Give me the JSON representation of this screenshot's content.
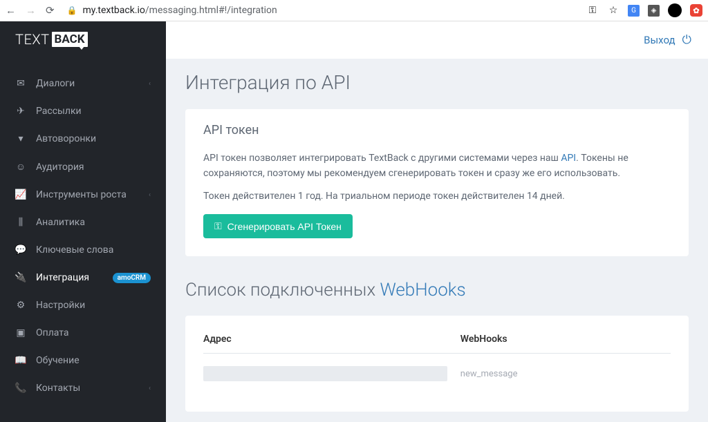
{
  "browser": {
    "url_domain": "my.textback.io",
    "url_path": "/messaging.html#!/integration"
  },
  "logo": {
    "part1": "TEXT",
    "part2": "BACK"
  },
  "sidebar": {
    "items": [
      {
        "label": "Диалоги",
        "icon": "✉",
        "chevron": true
      },
      {
        "label": "Рассылки",
        "icon": "✈"
      },
      {
        "label": "Автоворонки",
        "icon": "▼"
      },
      {
        "label": "Аудитория",
        "icon": "◉"
      },
      {
        "label": "Инструменты роста",
        "icon": "↗",
        "chevron": true
      },
      {
        "label": "Аналитика",
        "icon": "⫼"
      },
      {
        "label": "Ключевые слова",
        "icon": "💬"
      },
      {
        "label": "Интеграция",
        "icon": "⚡",
        "badge": "amoCRM",
        "active": true
      },
      {
        "label": "Настройки",
        "icon": "⚙"
      },
      {
        "label": "Оплата",
        "icon": "▣"
      },
      {
        "label": "Обучение",
        "icon": "📖"
      },
      {
        "label": "Контакты",
        "icon": "📞",
        "chevron": true
      }
    ]
  },
  "topbar": {
    "logout": "Выход"
  },
  "page": {
    "title": "Интеграция по API",
    "card_title": "API токен",
    "desc_before": "API токен позволяет интегрировать TextBack с другими системами через наш ",
    "desc_link": "API",
    "desc_after": ". Токены не сохраняются, поэтому мы рекомендуем сгенерировать токен и сразу же его использовать.",
    "validity": "Токен действителен 1 год. На триальном периоде токен действителен 14 дней.",
    "generate_btn": "Сгенерировать API Токен",
    "webhooks_title_prefix": "Список подключенных ",
    "webhooks_title_link": "WebHooks",
    "table": {
      "col_address": "Адрес",
      "col_webhooks": "WebHooks",
      "row_hook": "new_message"
    }
  }
}
